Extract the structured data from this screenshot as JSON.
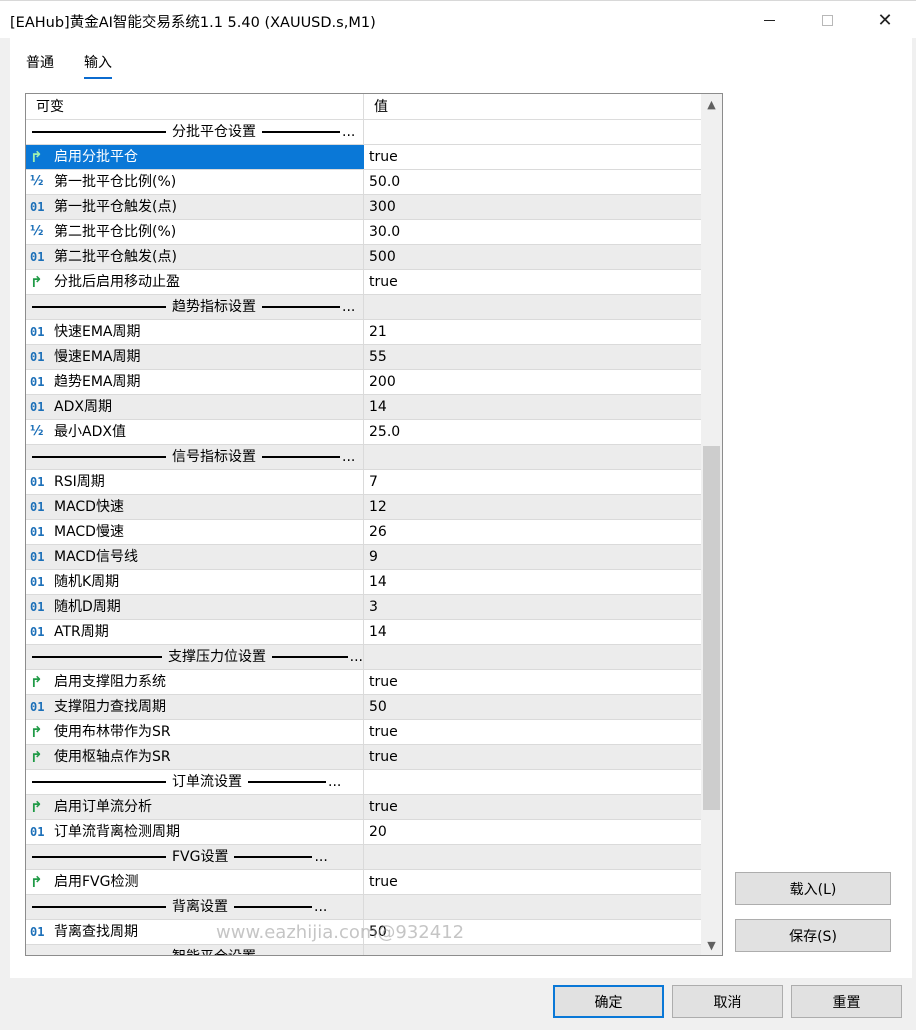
{
  "window": {
    "title": "[EAHub]黄金AI智能交易系统1.1 5.40 (XAUUSD.s,M1)",
    "min_icon": "minimize-icon",
    "max_icon": "maximize-icon",
    "close_icon": "close-icon",
    "close_glyph": "✕"
  },
  "tabs": [
    {
      "label": "普通"
    },
    {
      "label": "输入"
    }
  ],
  "grid": {
    "col_variable": "可变",
    "col_value": "值",
    "rows": [
      {
        "kind": "section",
        "name": "分批平仓设置"
      },
      {
        "kind": "bool",
        "icon": "↱",
        "name": "启用分批平仓",
        "value": "true",
        "selected": true
      },
      {
        "kind": "frac",
        "icon": "½",
        "name": "第一批平仓比例(%)",
        "value": "50.0"
      },
      {
        "kind": "int",
        "icon": "01",
        "name": "第一批平仓触发(点)",
        "value": "300"
      },
      {
        "kind": "frac",
        "icon": "½",
        "name": "第二批平仓比例(%)",
        "value": "30.0"
      },
      {
        "kind": "int",
        "icon": "01",
        "name": "第二批平仓触发(点)",
        "value": "500"
      },
      {
        "kind": "bool",
        "icon": "↱",
        "name": "分批后启用移动止盈",
        "value": "true"
      },
      {
        "kind": "section",
        "name": "趋势指标设置"
      },
      {
        "kind": "int",
        "icon": "01",
        "name": "快速EMA周期",
        "value": "21"
      },
      {
        "kind": "int",
        "icon": "01",
        "name": "慢速EMA周期",
        "value": "55"
      },
      {
        "kind": "int",
        "icon": "01",
        "name": "趋势EMA周期",
        "value": "200"
      },
      {
        "kind": "int",
        "icon": "01",
        "name": "ADX周期",
        "value": "14"
      },
      {
        "kind": "frac",
        "icon": "½",
        "name": "最小ADX值",
        "value": "25.0"
      },
      {
        "kind": "section",
        "name": "信号指标设置"
      },
      {
        "kind": "int",
        "icon": "01",
        "name": "RSI周期",
        "value": "7"
      },
      {
        "kind": "int",
        "icon": "01",
        "name": "MACD快速",
        "value": "12"
      },
      {
        "kind": "int",
        "icon": "01",
        "name": "MACD慢速",
        "value": "26"
      },
      {
        "kind": "int",
        "icon": "01",
        "name": "MACD信号线",
        "value": "9"
      },
      {
        "kind": "int",
        "icon": "01",
        "name": "随机K周期",
        "value": "14"
      },
      {
        "kind": "int",
        "icon": "01",
        "name": "随机D周期",
        "value": "3"
      },
      {
        "kind": "int",
        "icon": "01",
        "name": "ATR周期",
        "value": "14"
      },
      {
        "kind": "section",
        "name": "支撑压力位设置"
      },
      {
        "kind": "bool",
        "icon": "↱",
        "name": "启用支撑阻力系统",
        "value": "true"
      },
      {
        "kind": "int",
        "icon": "01",
        "name": "支撑阻力查找周期",
        "value": "50"
      },
      {
        "kind": "bool",
        "icon": "↱",
        "name": "使用布林带作为SR",
        "value": "true"
      },
      {
        "kind": "bool",
        "icon": "↱",
        "name": "使用枢轴点作为SR",
        "value": "true"
      },
      {
        "kind": "section",
        "name": "订单流设置"
      },
      {
        "kind": "bool",
        "icon": "↱",
        "name": "启用订单流分析",
        "value": "true"
      },
      {
        "kind": "int",
        "icon": "01",
        "name": "订单流背离检测周期",
        "value": "20"
      },
      {
        "kind": "section",
        "name": "FVG设置"
      },
      {
        "kind": "bool",
        "icon": "↱",
        "name": "启用FVG检测",
        "value": "true"
      },
      {
        "kind": "section",
        "name": "背离设置"
      },
      {
        "kind": "int",
        "icon": "01",
        "name": "背离查找周期",
        "value": "50"
      },
      {
        "kind": "section",
        "name": "智能平仓设置"
      }
    ]
  },
  "watermark": "www.eazhijia.com@932412",
  "buttons": {
    "load": "载入(L)",
    "save": "保存(S)",
    "ok": "确定",
    "cancel": "取消",
    "reset": "重置"
  },
  "colors": {
    "selection": "#0a78d7",
    "bool_icon": "#1f9a46",
    "number_icon": "#1b6fb8"
  }
}
